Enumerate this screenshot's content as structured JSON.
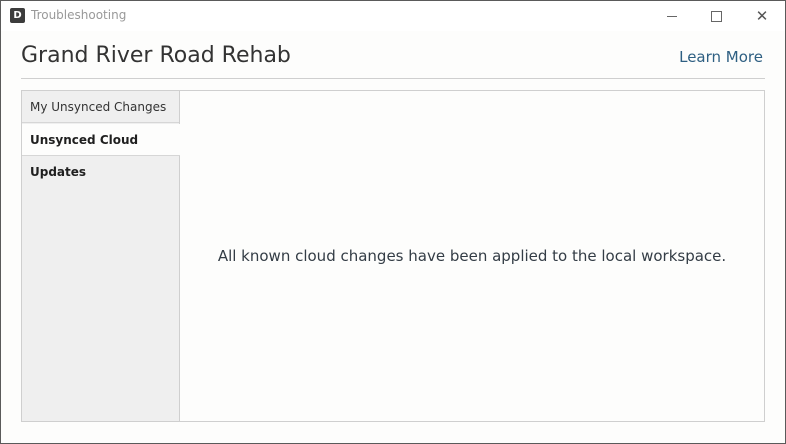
{
  "window": {
    "title": "Troubleshooting",
    "app_icon_letter": "D",
    "app_icon": "app-logo-icon",
    "controls": {
      "minimize": "minimize-icon",
      "maximize": "maximize-icon",
      "close": "close-icon",
      "close_glyph": "✕"
    }
  },
  "header": {
    "title": "Grand River Road Rehab",
    "learn_more": "Learn More"
  },
  "sidebar": {
    "items": [
      {
        "label": "My Unsynced Changes",
        "selected": false
      },
      {
        "label": "Unsynced Cloud Updates",
        "selected": true
      }
    ]
  },
  "content": {
    "message": "All known cloud changes have been applied to the local workspace."
  },
  "colors": {
    "link": "#2e5f82",
    "sidebar_bg": "#efefef",
    "content_bg": "#fdfdfc",
    "border": "#cfcfcf"
  }
}
